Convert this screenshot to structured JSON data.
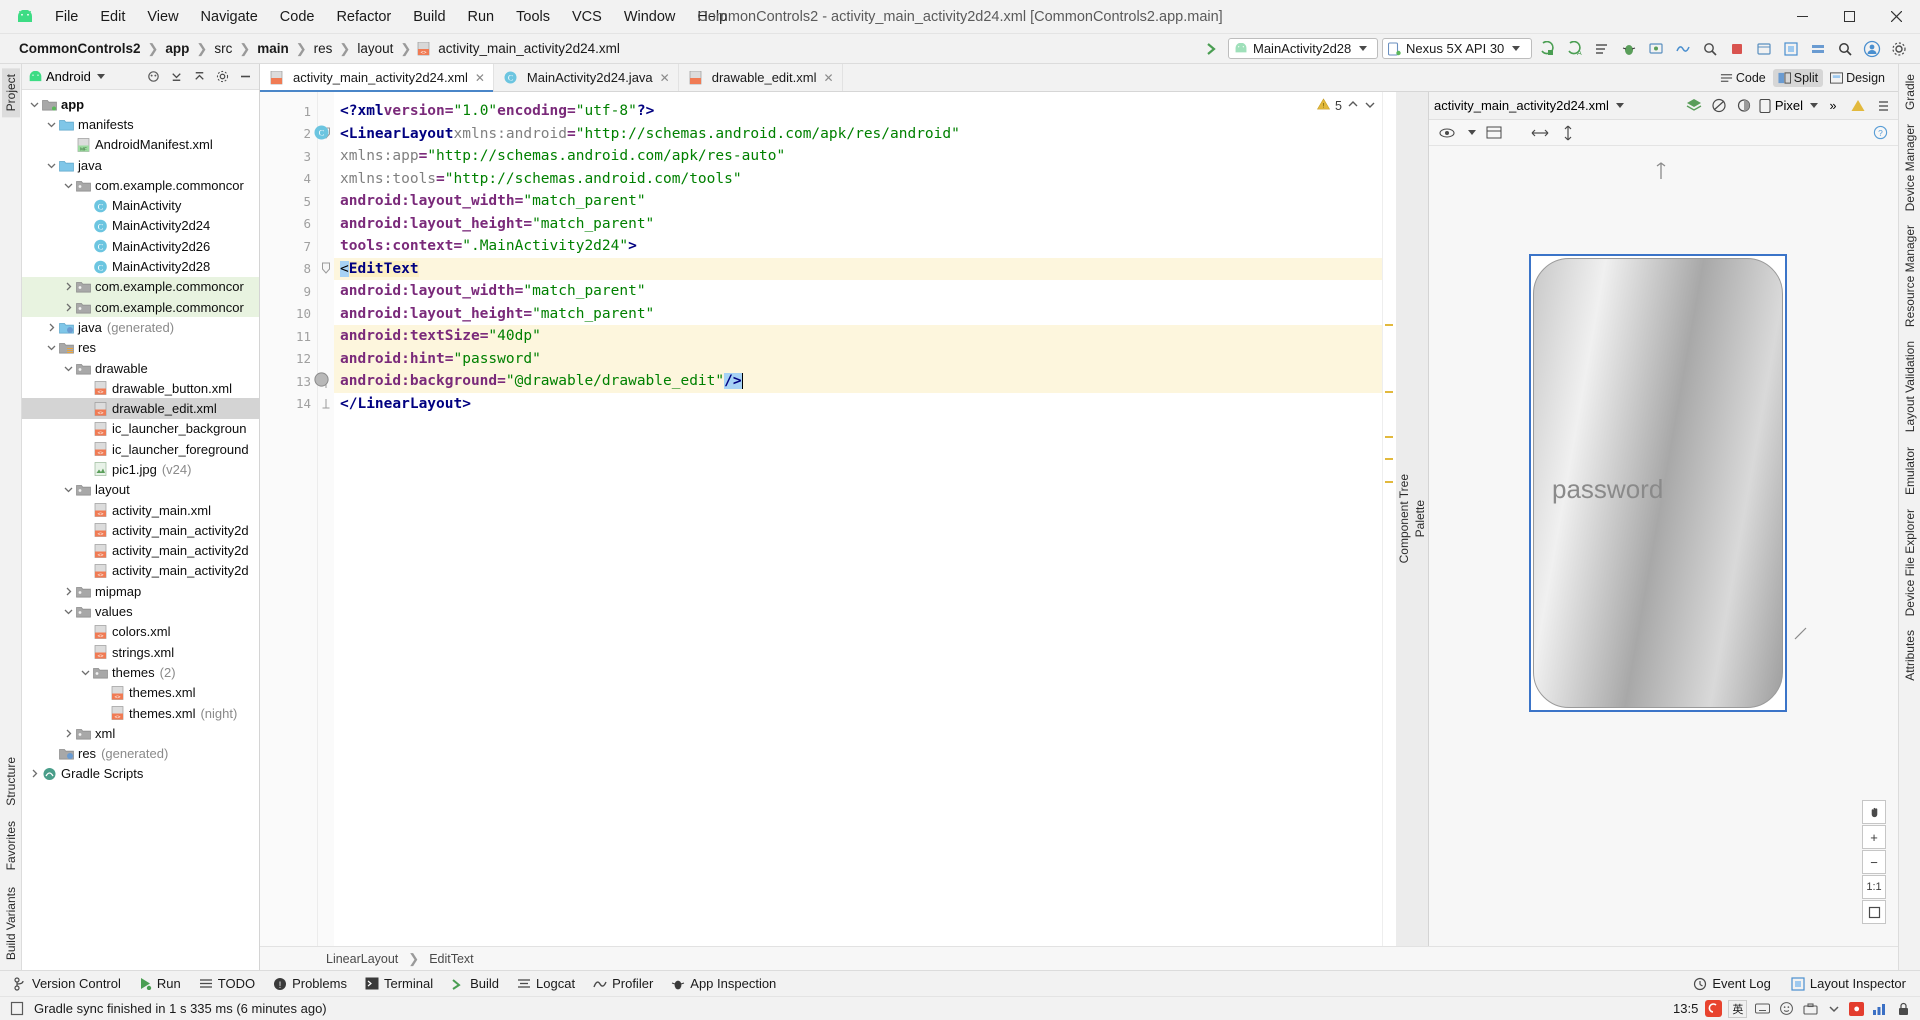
{
  "window": {
    "title": "CommonControls2 - activity_main_activity2d24.xml [CommonControls2.app.main]",
    "minimize": "─",
    "maximize": "❐",
    "close": "✕"
  },
  "menu": [
    "File",
    "Edit",
    "View",
    "Navigate",
    "Code",
    "Refactor",
    "Build",
    "Run",
    "Tools",
    "VCS",
    "Window",
    "Help"
  ],
  "breadcrumbs": [
    "CommonControls2",
    "app",
    "src",
    "main",
    "res",
    "layout",
    "activity_main_activity2d24.xml"
  ],
  "toolbar": {
    "run_config": "MainActivity2d28",
    "device": "Nexus 5X API 30",
    "icons": [
      "build-icon",
      "sync-icon",
      "avd-manager-icon",
      "debug-icon",
      "attach-debugger-icon",
      "profiler-icon",
      "stop-icon",
      "device-file-explorer-icon",
      "layout-inspector-icon",
      "search-icon",
      "account-icon",
      "settings-icon"
    ]
  },
  "project_panel": {
    "title": "Android",
    "header_icons": [
      "expand-icon",
      "collapse-icon",
      "settings-icon",
      "hide-icon"
    ],
    "tree": [
      {
        "indent": 0,
        "arrow": "v",
        "icon": "module",
        "label": "app",
        "bold": true,
        "state": "normal"
      },
      {
        "indent": 1,
        "arrow": "v",
        "icon": "folder",
        "label": "manifests",
        "bold": false,
        "state": "normal"
      },
      {
        "indent": 2,
        "arrow": "",
        "icon": "manifest",
        "label": "AndroidManifest.xml",
        "bold": false,
        "state": "normal"
      },
      {
        "indent": 1,
        "arrow": "v",
        "icon": "folder",
        "label": "java",
        "bold": false,
        "state": "normal"
      },
      {
        "indent": 2,
        "arrow": "v",
        "icon": "package",
        "label": "com.example.commoncor",
        "bold": false,
        "state": "normal"
      },
      {
        "indent": 3,
        "arrow": "",
        "icon": "class",
        "label": "MainActivity",
        "bold": false,
        "state": "normal"
      },
      {
        "indent": 3,
        "arrow": "",
        "icon": "class",
        "label": "MainActivity2d24",
        "bold": false,
        "state": "normal"
      },
      {
        "indent": 3,
        "arrow": "",
        "icon": "class",
        "label": "MainActivity2d26",
        "bold": false,
        "state": "normal"
      },
      {
        "indent": 3,
        "arrow": "",
        "icon": "class",
        "label": "MainActivity2d28",
        "bold": false,
        "state": "normal"
      },
      {
        "indent": 2,
        "arrow": ">",
        "icon": "package",
        "label": "com.example.commoncor",
        "bold": false,
        "state": "green"
      },
      {
        "indent": 2,
        "arrow": ">",
        "icon": "package",
        "label": "com.example.commoncor",
        "bold": false,
        "state": "green"
      },
      {
        "indent": 1,
        "arrow": ">",
        "icon": "folder-gen",
        "label": "java",
        "suffix": "(generated)",
        "bold": false,
        "state": "normal"
      },
      {
        "indent": 1,
        "arrow": "v",
        "icon": "res",
        "label": "res",
        "bold": false,
        "state": "normal"
      },
      {
        "indent": 2,
        "arrow": "v",
        "icon": "package",
        "label": "drawable",
        "bold": false,
        "state": "normal"
      },
      {
        "indent": 3,
        "arrow": "",
        "icon": "xml",
        "label": "drawable_button.xml",
        "bold": false,
        "state": "normal"
      },
      {
        "indent": 3,
        "arrow": "",
        "icon": "xml",
        "label": "drawable_edit.xml",
        "bold": false,
        "state": "selected"
      },
      {
        "indent": 3,
        "arrow": "",
        "icon": "xml",
        "label": "ic_launcher_backgroun",
        "bold": false,
        "state": "normal"
      },
      {
        "indent": 3,
        "arrow": "",
        "icon": "xml",
        "label": "ic_launcher_foreground",
        "bold": false,
        "state": "normal"
      },
      {
        "indent": 3,
        "arrow": "",
        "icon": "img",
        "label": "pic1.jpg",
        "suffix": "(v24)",
        "bold": false,
        "state": "normal"
      },
      {
        "indent": 2,
        "arrow": "v",
        "icon": "package",
        "label": "layout",
        "bold": false,
        "state": "normal"
      },
      {
        "indent": 3,
        "arrow": "",
        "icon": "xml",
        "label": "activity_main.xml",
        "bold": false,
        "state": "normal"
      },
      {
        "indent": 3,
        "arrow": "",
        "icon": "xml",
        "label": "activity_main_activity2d",
        "bold": false,
        "state": "normal"
      },
      {
        "indent": 3,
        "arrow": "",
        "icon": "xml",
        "label": "activity_main_activity2d",
        "bold": false,
        "state": "normal"
      },
      {
        "indent": 3,
        "arrow": "",
        "icon": "xml",
        "label": "activity_main_activity2d",
        "bold": false,
        "state": "normal"
      },
      {
        "indent": 2,
        "arrow": ">",
        "icon": "package",
        "label": "mipmap",
        "bold": false,
        "state": "normal"
      },
      {
        "indent": 2,
        "arrow": "v",
        "icon": "package",
        "label": "values",
        "bold": false,
        "state": "normal"
      },
      {
        "indent": 3,
        "arrow": "",
        "icon": "xml",
        "label": "colors.xml",
        "bold": false,
        "state": "normal"
      },
      {
        "indent": 3,
        "arrow": "",
        "icon": "xml",
        "label": "strings.xml",
        "bold": false,
        "state": "normal"
      },
      {
        "indent": 3,
        "arrow": "v",
        "icon": "package",
        "label": "themes",
        "suffix": "(2)",
        "bold": false,
        "state": "normal"
      },
      {
        "indent": 4,
        "arrow": "",
        "icon": "xml",
        "label": "themes.xml",
        "bold": false,
        "state": "normal"
      },
      {
        "indent": 4,
        "arrow": "",
        "icon": "xml",
        "label": "themes.xml",
        "suffix": "(night)",
        "bold": false,
        "state": "normal"
      },
      {
        "indent": 2,
        "arrow": ">",
        "icon": "package",
        "label": "xml",
        "bold": false,
        "state": "normal"
      },
      {
        "indent": 1,
        "arrow": "",
        "icon": "res-gen",
        "label": "res",
        "suffix": "(generated)",
        "bold": false,
        "state": "normal"
      },
      {
        "indent": 0,
        "arrow": ">",
        "icon": "gradle",
        "label": "Gradle Scripts",
        "bold": false,
        "state": "normal"
      }
    ]
  },
  "left_rail": {
    "top": [
      "Project"
    ],
    "bottom": [
      "Structure",
      "Favorites",
      "Build Variants"
    ]
  },
  "right_rail": [
    "Gradle",
    "Device Manager",
    "Resource Manager",
    "Layout Validation",
    "Emulator",
    "Device File Explorer",
    "Attributes"
  ],
  "editor_tabs": [
    {
      "label": "activity_main_activity2d24.xml",
      "icon": "xml",
      "active": true
    },
    {
      "label": "MainActivity2d24.java",
      "icon": "class",
      "active": false
    },
    {
      "label": "drawable_edit.xml",
      "icon": "xml",
      "active": false
    }
  ],
  "view_modes": [
    {
      "label": "Code",
      "icon": "code-icon",
      "selected": false
    },
    {
      "label": "Split",
      "icon": "split-icon",
      "selected": true
    },
    {
      "label": "Design",
      "icon": "design-icon",
      "selected": false
    }
  ],
  "editor": {
    "warning_count": "5",
    "lines": [
      {
        "n": "1",
        "text": "<?xml version=\"1.0\" encoding=\"utf-8\"?>"
      },
      {
        "n": "2",
        "text": "<LinearLayout xmlns:android=\"http://schemas.android.com/apk/res/android\""
      },
      {
        "n": "3",
        "text": "    xmlns:app=\"http://schemas.android.com/apk/res-auto\""
      },
      {
        "n": "4",
        "text": "    xmlns:tools=\"http://schemas.android.com/tools\""
      },
      {
        "n": "5",
        "text": "    android:layout_width=\"match_parent\""
      },
      {
        "n": "6",
        "text": "    android:layout_height=\"match_parent\""
      },
      {
        "n": "7",
        "text": "    tools:context=\".MainActivity2d24\">"
      },
      {
        "n": "8",
        "text": "<EditText"
      },
      {
        "n": "9",
        "text": "    android:layout_width=\"match_parent\""
      },
      {
        "n": "10",
        "text": "    android:layout_height=\"match_parent\""
      },
      {
        "n": "11",
        "text": "    android:textSize=\"40dp\""
      },
      {
        "n": "12",
        "text": "    android:hint=\"password\""
      },
      {
        "n": "13",
        "text": "    android:background=\"@drawable/drawable_edit\"/>"
      },
      {
        "n": "14",
        "text": "</LinearLayout>"
      }
    ],
    "breadcrumb_bottom": [
      "LinearLayout",
      "EditText"
    ]
  },
  "preview": {
    "filename": "activity_main_activity2d24.xml",
    "device": "Pixel",
    "palette_label": "Palette",
    "component_tree_label": "Component Tree",
    "hint_text": "password",
    "zoom_buttons": [
      "pan-icon",
      "zoom-in-icon",
      "zoom-out-icon",
      "zoom-actual-icon",
      "zoom-fit-icon"
    ],
    "zoom_actual_label": "1:1"
  },
  "bottom_tools": [
    {
      "label": "Version Control",
      "icon": "branch-icon"
    },
    {
      "label": "Run",
      "icon": "run-icon"
    },
    {
      "label": "TODO",
      "icon": "todo-icon"
    },
    {
      "label": "Problems",
      "icon": "problems-icon"
    },
    {
      "label": "Terminal",
      "icon": "terminal-icon"
    },
    {
      "label": "Build",
      "icon": "build-icon"
    },
    {
      "label": "Logcat",
      "icon": "logcat-icon"
    },
    {
      "label": "Profiler",
      "icon": "profiler-icon"
    },
    {
      "label": "App Inspection",
      "icon": "inspection-icon"
    }
  ],
  "bottom_tools_right": [
    {
      "label": "Event Log",
      "icon": "event-log-icon"
    },
    {
      "label": "Layout Inspector",
      "icon": "layout-inspector-icon"
    }
  ],
  "status": {
    "message": "Gradle sync finished in 1 s 335 ms (6 minutes ago)",
    "clock": "13:5",
    "ime": "英"
  },
  "colors": {
    "accent": "#4a86c8",
    "tag": "#000080",
    "attr": "#7a2a7a",
    "value": "#008000",
    "highlight": "#fdf6dd",
    "selection": "#a6d2f5",
    "green_row": "#e8f3e0",
    "warning": "#e2b93d"
  }
}
